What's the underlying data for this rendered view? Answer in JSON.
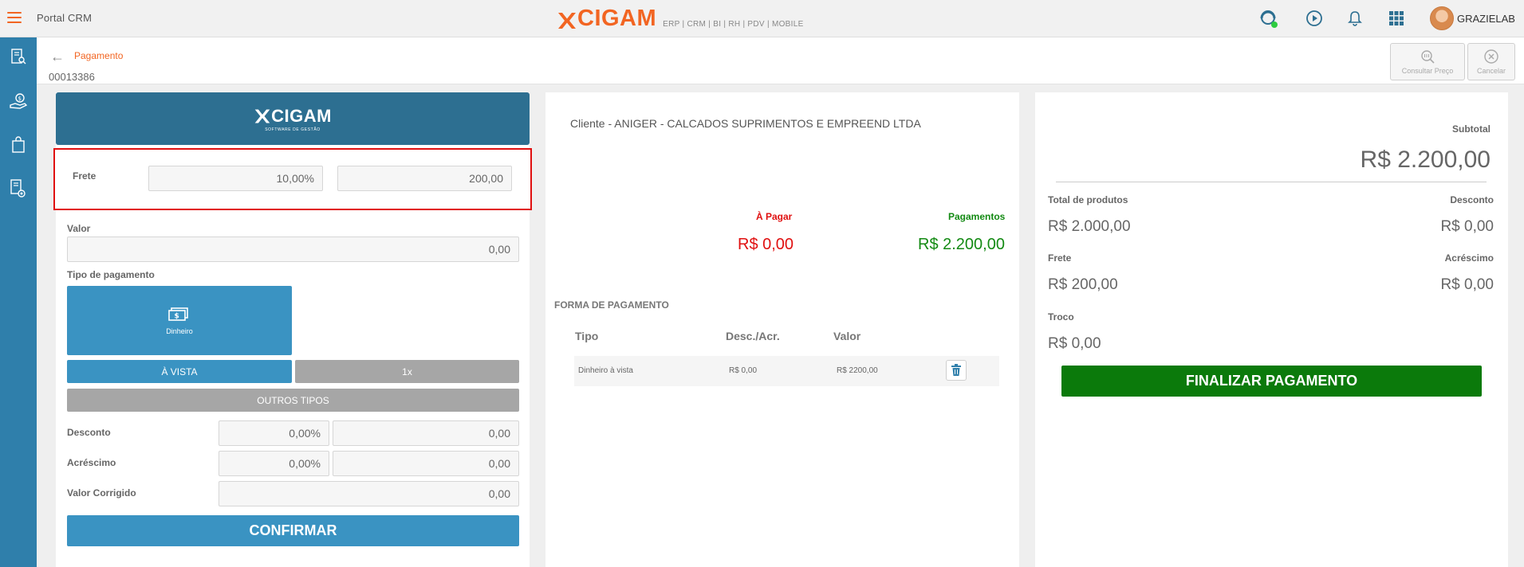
{
  "header": {
    "app_title": "Portal CRM",
    "brand_name": "CIGAM",
    "brand_modules": "ERP | CRM | BI | RH | PDV | MOBILE",
    "user_name": "GRAZIELAB"
  },
  "colors": {
    "accent": "#f26522",
    "sidebar": "#2f7fab",
    "primary_button": "#3a93c2",
    "finalize_button": "#0b7a0b",
    "a_pagar": "#e01010",
    "pagamentos": "#138a13"
  },
  "subheader": {
    "breadcrumb": "Pagamento",
    "order_number": "00013386",
    "consultar_preco": "Consultar Preço",
    "cancelar": "Cancelar"
  },
  "left_panel": {
    "logo_text": "CIGAM",
    "logo_tagline": "SOFTWARE DE GESTÃO",
    "frete_label": "Frete",
    "frete_percent": "10,00%",
    "frete_value": "200,00",
    "valor_label": "Valor",
    "valor_value": "0,00",
    "tipo_pagamento_label": "Tipo de pagamento",
    "payment_tile_label": "Dinheiro",
    "a_vista_button": "À VISTA",
    "installments_button": "1x",
    "outros_tipos_button": "OUTROS TIPOS",
    "desconto_label": "Desconto",
    "desconto_percent": "0,00%",
    "desconto_value": "0,00",
    "acrescimo_label": "Acréscimo",
    "acrescimo_percent": "0,00%",
    "acrescimo_value": "0,00",
    "valor_corrigido_label": "Valor Corrigido",
    "valor_corrigido_value": "0,00",
    "confirm_button": "CONFIRMAR"
  },
  "middle_panel": {
    "client": "Cliente - ANIGER - CALCADOS SUPRIMENTOS E EMPREEND LTDA",
    "a_pagar_label": "À Pagar",
    "a_pagar_value": "R$ 0,00",
    "pagamentos_label": "Pagamentos",
    "pagamentos_value": "R$ 2.200,00",
    "forma_pagamento_title": "FORMA DE PAGAMENTO",
    "columns": [
      "Tipo",
      "Desc./Acr.",
      "Valor"
    ],
    "rows": [
      {
        "tipo": "Dinheiro à vista",
        "desc_acr": "R$ 0,00",
        "valor": "R$ 2200,00"
      }
    ]
  },
  "right_panel": {
    "subtotal_label": "Subtotal",
    "subtotal_value": "R$ 2.200,00",
    "total_produtos_label": "Total de produtos",
    "total_produtos_value": "R$ 2.000,00",
    "desconto_label": "Desconto",
    "desconto_value": "R$ 0,00",
    "frete_label": "Frete",
    "frete_value": "R$ 200,00",
    "acrescimo_label": "Acréscimo",
    "acrescimo_value": "R$ 0,00",
    "troco_label": "Troco",
    "troco_value": "R$ 0,00",
    "finalize_button": "FINALIZAR PAGAMENTO"
  }
}
